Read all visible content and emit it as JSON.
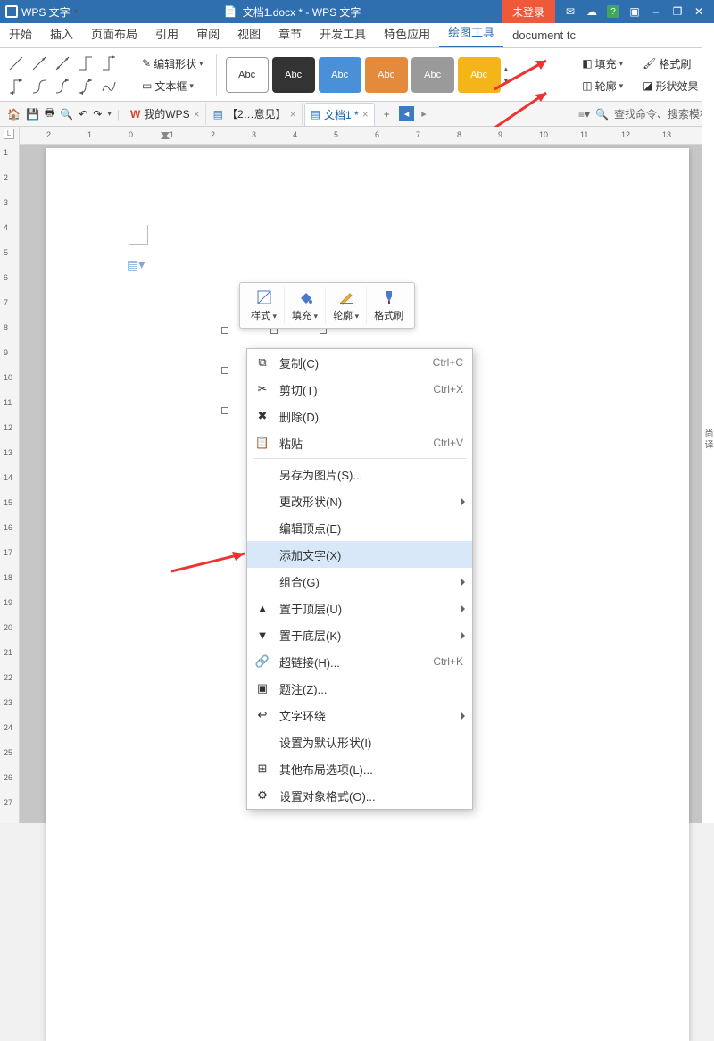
{
  "titlebar": {
    "app_name": "WPS 文字",
    "doc_title": "文档1.docx * - WPS 文字",
    "login": "未登录",
    "window_controls": [
      "–",
      "❐",
      "✕"
    ]
  },
  "tabs": {
    "items": [
      "开始",
      "插入",
      "页面布局",
      "引用",
      "审阅",
      "视图",
      "章节",
      "开发工具",
      "特色应用",
      "绘图工具",
      "document tc"
    ],
    "active_index": 9
  },
  "ribbon": {
    "edit_shape": "编辑形状",
    "text_box": "文本框",
    "abc_label": "Abc",
    "fill": "填充",
    "format_painter": "格式刷",
    "outline": "轮廓",
    "shape_effect": "形状效果"
  },
  "doctabs": {
    "items": [
      {
        "label": "我的WPS",
        "closable": true,
        "prefix": "W"
      },
      {
        "label": "【2…意见】",
        "closable": true,
        "icon": "doc"
      },
      {
        "label": "文档1 *",
        "closable": true,
        "icon": "doc",
        "active": true
      }
    ],
    "add": "+",
    "search_placeholder": "查找命令、搜索模板"
  },
  "minitoolbar": {
    "items": [
      {
        "label": "样式",
        "dd": true
      },
      {
        "label": "填充",
        "dd": true
      },
      {
        "label": "轮廓",
        "dd": true
      },
      {
        "label": "格式刷",
        "dd": false
      }
    ]
  },
  "context_menu": {
    "items": [
      {
        "icon": "copy",
        "label": "复制(C)",
        "shortcut": "Ctrl+C"
      },
      {
        "icon": "cut",
        "label": "剪切(T)",
        "shortcut": "Ctrl+X"
      },
      {
        "icon": "delete",
        "label": "删除(D)"
      },
      {
        "icon": "paste",
        "label": "粘贴",
        "shortcut": "Ctrl+V"
      },
      {
        "sep": true
      },
      {
        "label": "另存为图片(S)..."
      },
      {
        "label": "更改形状(N)",
        "sub": true
      },
      {
        "label": "编辑顶点(E)"
      },
      {
        "label": "添加文字(X)",
        "highlight": true
      },
      {
        "label": "组合(G)",
        "sub": true
      },
      {
        "icon": "front",
        "label": "置于顶层(U)",
        "sub": true
      },
      {
        "icon": "back",
        "label": "置于底层(K)",
        "sub": true
      },
      {
        "icon": "link",
        "label": "超链接(H)...",
        "shortcut": "Ctrl+K"
      },
      {
        "icon": "caption",
        "label": "题注(Z)..."
      },
      {
        "icon": "wrap",
        "label": "文字环绕",
        "sub": true
      },
      {
        "label": "设置为默认形状(I)"
      },
      {
        "icon": "layout",
        "label": "其他布局选项(L)..."
      },
      {
        "icon": "format",
        "label": "设置对象格式(O)..."
      }
    ]
  },
  "ruler": {
    "h_labels": [
      "2",
      "1",
      "0",
      "1",
      "2",
      "3",
      "4",
      "5",
      "6",
      "7",
      "8",
      "9",
      "10",
      "11",
      "12",
      "13"
    ],
    "v_labels": [
      "1",
      "2",
      "3",
      "4",
      "5",
      "6",
      "7",
      "8",
      "9",
      "10",
      "11",
      "12",
      "13",
      "14",
      "15",
      "16",
      "17",
      "18",
      "19",
      "20",
      "21",
      "22",
      "23",
      "24",
      "25",
      "26",
      "27"
    ]
  },
  "rightsliver_label": "尚 译"
}
